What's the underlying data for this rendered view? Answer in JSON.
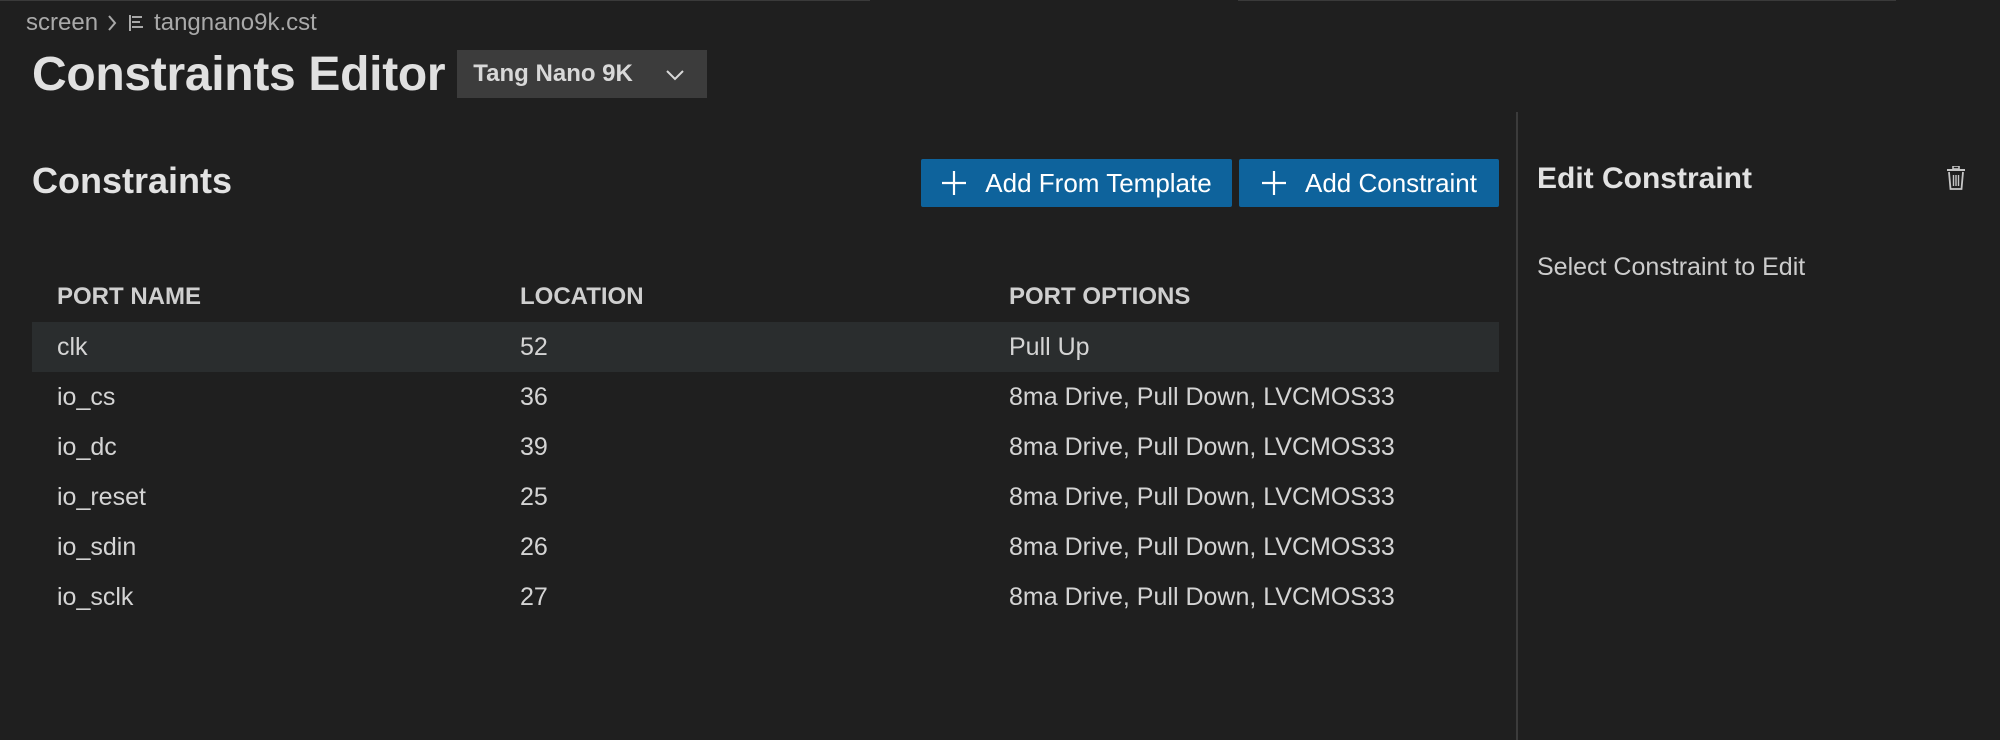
{
  "breadcrumb": {
    "folder": "screen",
    "file": "tangnano9k.cst"
  },
  "editor": {
    "title": "Constraints Editor",
    "board": "Tang Nano 9K"
  },
  "constraints": {
    "title": "Constraints",
    "add_from_template_label": "Add From Template",
    "add_constraint_label": "Add Constraint",
    "columns": [
      "PORT NAME",
      "LOCATION",
      "PORT OPTIONS"
    ],
    "rows": [
      {
        "port": "clk",
        "location": "52",
        "options": "Pull Up"
      },
      {
        "port": "io_cs",
        "location": "36",
        "options": "8ma Drive, Pull Down, LVCMOS33"
      },
      {
        "port": "io_dc",
        "location": "39",
        "options": "8ma Drive, Pull Down, LVCMOS33"
      },
      {
        "port": "io_reset",
        "location": "25",
        "options": "8ma Drive, Pull Down, LVCMOS33"
      },
      {
        "port": "io_sdin",
        "location": "26",
        "options": "8ma Drive, Pull Down, LVCMOS33"
      },
      {
        "port": "io_sclk",
        "location": "27",
        "options": "8ma Drive, Pull Down, LVCMOS33"
      }
    ]
  },
  "edit_panel": {
    "title": "Edit Constraint",
    "empty_message": "Select Constraint to Edit"
  },
  "icons": {
    "chevron": "chevron-right-icon",
    "file": "file-lines-icon",
    "dropdown": "chevron-down-icon",
    "plus": "plus-icon",
    "trash": "trash-icon"
  },
  "colors": {
    "background": "#1f1f1f",
    "button": "#0e639c",
    "select": "#3c3c3c",
    "selected_row": "#2a2d2e"
  }
}
